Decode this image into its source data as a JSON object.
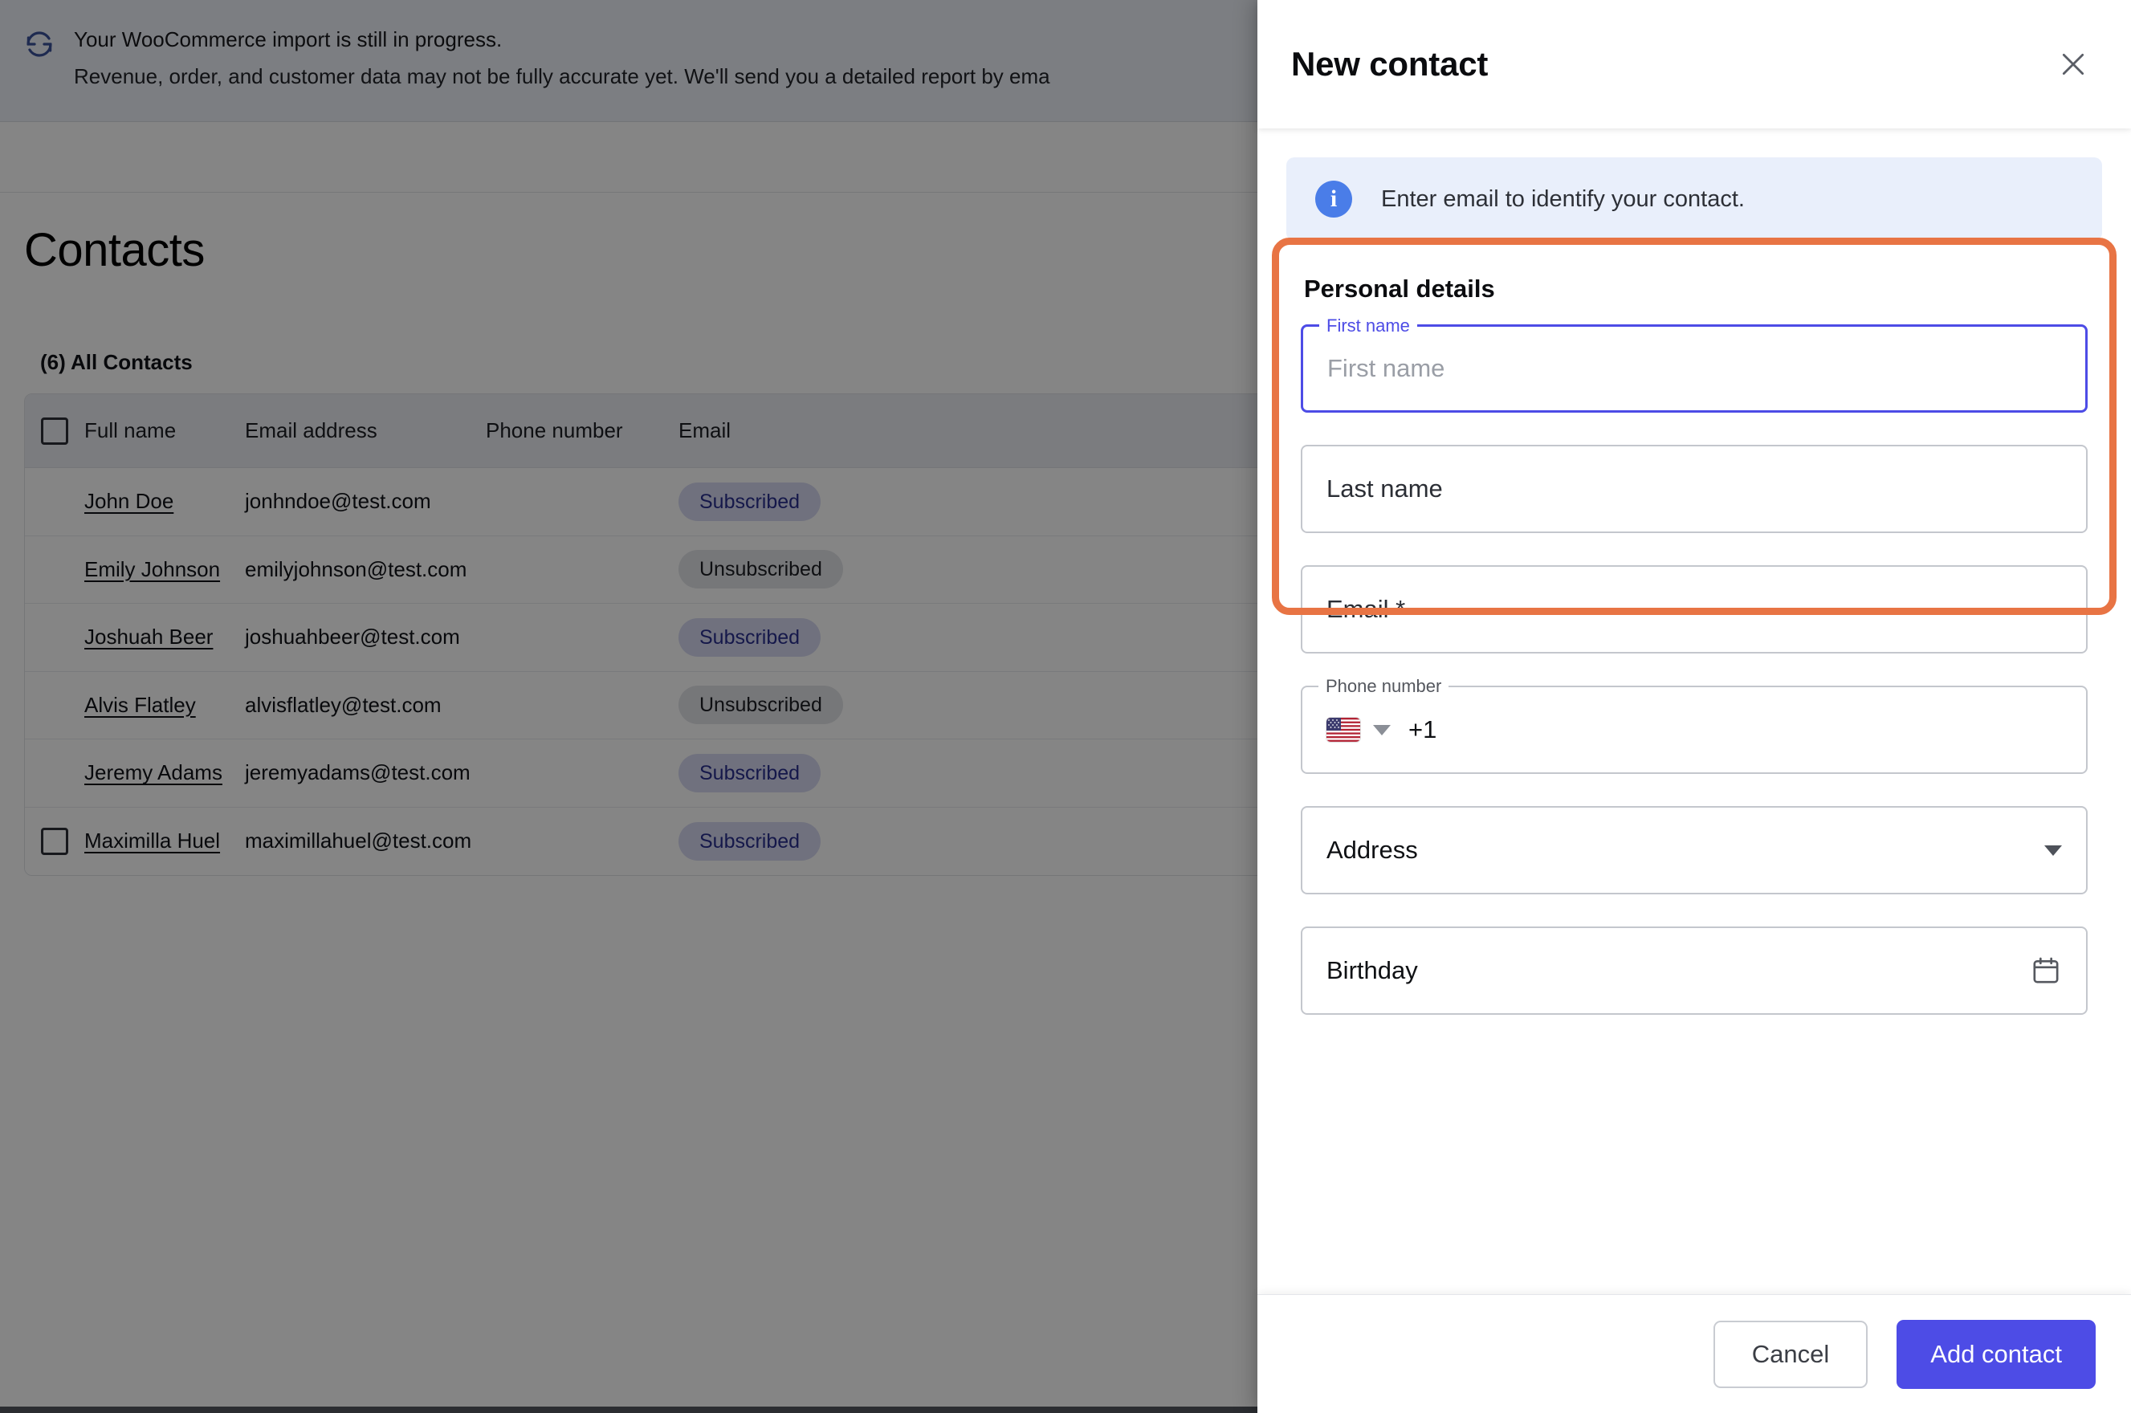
{
  "notice": {
    "icon": "sync-icon",
    "title": "Your WooCommerce import is still in progress.",
    "subtitle": "Revenue, order, and customer data may not be fully accurate yet. We'll send you a detailed report by ema"
  },
  "page": {
    "title": "Contacts",
    "list_count_label": "(6) All Contacts"
  },
  "table": {
    "columns": [
      "Full name",
      "Email address",
      "Phone number",
      "Email"
    ],
    "rows": [
      {
        "name": "John Doe",
        "email": "jonhndoe@test.com",
        "phone": "",
        "status": "Subscribed",
        "status_type": "sub",
        "checked": false,
        "checkbox_visible": false
      },
      {
        "name": "Emily Johnson",
        "email": "emilyjohnson@test.com",
        "phone": "",
        "status": "Unsubscribed",
        "status_type": "unsub",
        "checked": false,
        "checkbox_visible": false
      },
      {
        "name": "Joshuah Beer",
        "email": "joshuahbeer@test.com",
        "phone": "",
        "status": "Subscribed",
        "status_type": "sub",
        "checked": false,
        "checkbox_visible": false
      },
      {
        "name": "Alvis Flatley",
        "email": "alvisflatley@test.com",
        "phone": "",
        "status": "Unsubscribed",
        "status_type": "unsub",
        "checked": false,
        "checkbox_visible": false
      },
      {
        "name": "Jeremy Adams",
        "email": "jeremyadams@test.com",
        "phone": "",
        "status": "Subscribed",
        "status_type": "sub",
        "checked": false,
        "checkbox_visible": false
      },
      {
        "name": "Maximilla Huel",
        "email": "maximillahuel@test.com",
        "phone": "",
        "status": "Subscribed",
        "status_type": "sub",
        "checked": false,
        "checkbox_visible": true
      }
    ]
  },
  "drawer": {
    "title": "New contact",
    "close_icon": "close-icon",
    "info": {
      "icon": "info-icon",
      "text": "Enter email to identify your contact."
    },
    "section_title": "Personal details",
    "fields": {
      "first_name": {
        "label": "First name",
        "placeholder": "First name",
        "value": "",
        "focused": true
      },
      "last_name": {
        "label": "Last name",
        "placeholder": "Last name",
        "value": ""
      },
      "email": {
        "label": "Email *",
        "placeholder": "Email *",
        "value": ""
      },
      "phone": {
        "label": "Phone number",
        "flag": "us-flag-icon",
        "dial_code": "+1",
        "value": ""
      },
      "address": {
        "label": "Address",
        "placeholder": "Address",
        "value": "",
        "icon": "chevron-down-icon"
      },
      "birthday": {
        "label": "Birthday",
        "placeholder": "Birthday",
        "value": "",
        "icon": "calendar-icon"
      }
    },
    "footer": {
      "cancel_label": "Cancel",
      "submit_label": "Add contact"
    }
  },
  "colors": {
    "accent": "#4d4ce6",
    "highlight": "#e87444",
    "info": "#4a7de8",
    "chip_subscribed_bg": "#d7d9f2",
    "chip_subscribed_fg": "#2a2f8f",
    "chip_unsubscribed_bg": "#e3e4e8"
  }
}
